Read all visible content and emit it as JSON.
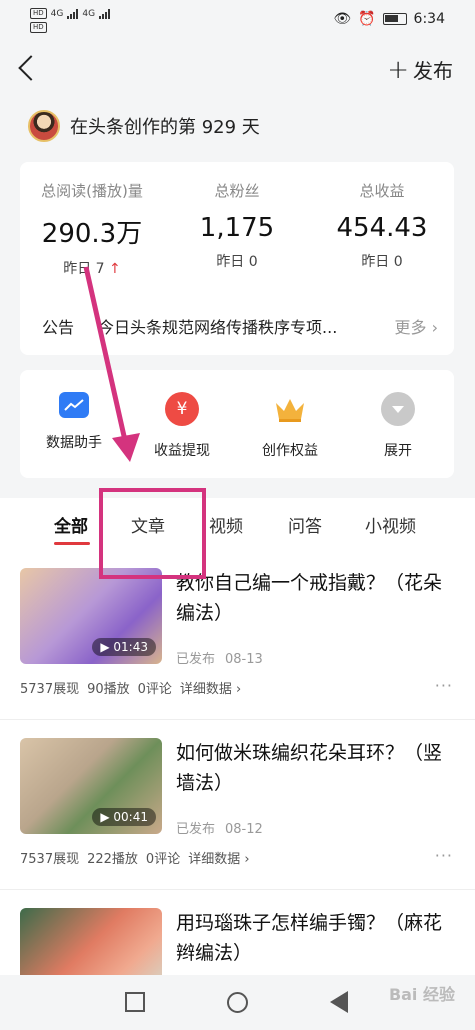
{
  "status_bar": {
    "time": "6:34",
    "hd": "HD",
    "net1": "4G",
    "net2": "4G"
  },
  "header": {
    "back_icon": "back-arrow-icon",
    "publish_label": "发布",
    "publish_icon": "plus-icon"
  },
  "creator": {
    "text": "在头条创作的第 929 天"
  },
  "stats": [
    {
      "label": "总阅读(播放)量",
      "value": "290.3万",
      "sub": "昨日 7",
      "trend": "↑"
    },
    {
      "label": "总粉丝",
      "value": "1,175",
      "sub": "昨日 0"
    },
    {
      "label": "总收益",
      "value": "454.43",
      "sub": "昨日 0"
    }
  ],
  "notice": {
    "tag": "公告",
    "text": "今日头条规范网络传播秩序专项...",
    "more": "更多 ›"
  },
  "tools": [
    {
      "label": "数据助手",
      "icon": "chart-icon",
      "color": "#2f7bf5"
    },
    {
      "label": "收益提现",
      "icon": "yen-icon",
      "color": "#ee4b44"
    },
    {
      "label": "创作权益",
      "icon": "crown-icon",
      "color": "#f3b23c"
    },
    {
      "label": "展开",
      "icon": "expand-icon",
      "color": "#c9c9c9"
    }
  ],
  "tabs": [
    "全部",
    "文章",
    "视频",
    "问答",
    "小视频"
  ],
  "articles": [
    {
      "title": "教你自己编一个戒指戴？（花朵编法）",
      "status": "已发布",
      "date": "08-13",
      "duration": "01:43",
      "views": "5737展现",
      "plays": "90播放",
      "comments": "0评论",
      "details": "详细数据 ›"
    },
    {
      "title": "如何做米珠编织花朵耳环？（竖墙法）",
      "status": "已发布",
      "date": "08-12",
      "duration": "00:41",
      "views": "7537展现",
      "plays": "222播放",
      "comments": "0评论",
      "details": "详细数据 ›"
    },
    {
      "title": "用玛瑙珠子怎样编手镯？（麻花辫编法）",
      "status": "",
      "date": "",
      "duration": "",
      "views": "",
      "plays": "",
      "comments": "",
      "details": ""
    }
  ],
  "more_dots": "···",
  "watermark": "Bai 经验",
  "colors": {
    "accent_red": "#e0393e",
    "annotation": "#d4337e"
  }
}
